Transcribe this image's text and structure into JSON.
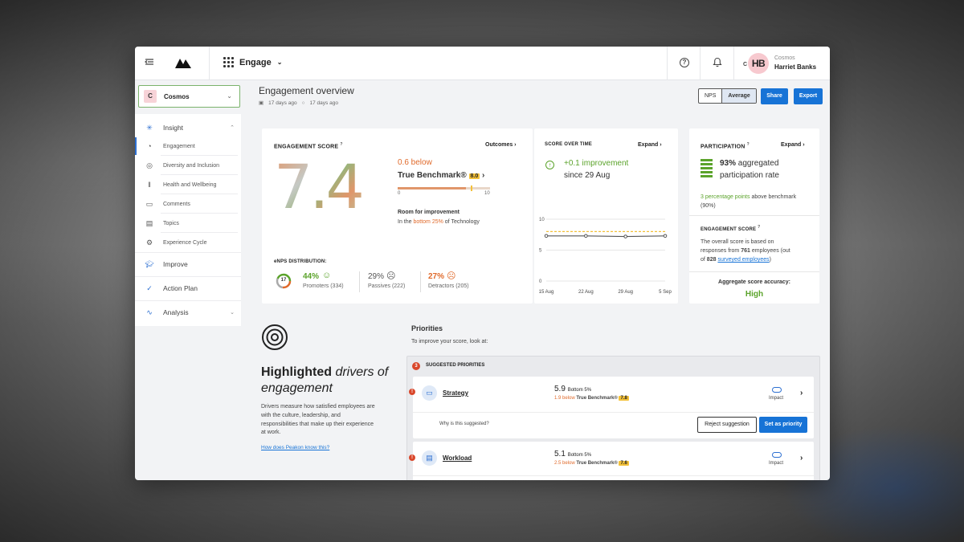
{
  "topbar": {
    "product_label": "Engage",
    "user_org": "Cosmos",
    "user_name": "Harriet Banks",
    "avatar_initials": "HB",
    "avatar_org_initial": "C"
  },
  "org_selector": {
    "badge": "C",
    "name": "Cosmos"
  },
  "sidebar": {
    "insight_label": "Insight",
    "items": [
      {
        "label": "Engagement",
        "icon": "gauge-icon"
      },
      {
        "label": "Diversity and Inclusion",
        "icon": "camera-icon"
      },
      {
        "label": "Health and Wellbeing",
        "icon": "thermometer-icon"
      },
      {
        "label": "Comments",
        "icon": "comment-icon"
      },
      {
        "label": "Topics",
        "icon": "topics-icon"
      },
      {
        "label": "Experience Cycle",
        "icon": "cycle-icon"
      }
    ],
    "improve_label": "Improve",
    "action_plan_label": "Action Plan",
    "analysis_label": "Analysis"
  },
  "header": {
    "title": "Engagement overview",
    "date_1": "17 days ago",
    "date_2": "17 days ago",
    "toggle_nps": "NPS",
    "toggle_average": "Average",
    "share_label": "Share",
    "export_label": "Export"
  },
  "engagement_card": {
    "title": "ENGAGEMENT SCORE",
    "outcomes_link": "Outcomes",
    "score": "7.4",
    "below_text": "0.6 below",
    "benchmark_label": "True Benchmark®",
    "benchmark_value": "8.0",
    "scale_min": "0",
    "scale_max": "10",
    "score_fraction": 0.74,
    "benchmark_fraction": 0.8,
    "room_title": "Room for improvement",
    "room_prefix": "In the",
    "room_highlight": "bottom 25%",
    "room_suffix": "of Technology",
    "enps_title": "eNPS DISTRIBUTION:",
    "enps_score": "17",
    "promoters_pct": "44%",
    "promoters_label": "Promoters (334)",
    "passives_pct": "29%",
    "passives_label": "Passives (222)",
    "detractors_pct": "27%",
    "detractors_label": "Detractors (205)"
  },
  "score_over_time": {
    "title": "SCORE OVER TIME",
    "expand_label": "Expand",
    "improvement": "+0.1 improvement",
    "since": "since 29 Aug"
  },
  "chart_data": {
    "type": "line",
    "x": [
      "15 Aug",
      "22 Aug",
      "29 Aug",
      "5 Sep"
    ],
    "series": [
      {
        "values": [
          7.3,
          7.3,
          7.2,
          7.3
        ]
      },
      {
        "values": [
          8.0,
          8.0,
          8.0,
          8.0
        ]
      }
    ],
    "yticks": [
      "10",
      "5",
      "0"
    ],
    "ylim": [
      0,
      10
    ],
    "xlabel": "",
    "ylabel": "",
    "grid": true,
    "colors": {
      "score": "#555555",
      "benchmark": "#f3c13a"
    }
  },
  "participation": {
    "title": "PARTICIPATION",
    "expand_label": "Expand",
    "rate_pct": "93%",
    "rate_text1": "aggregated",
    "rate_text2": "participation rate",
    "bench_highlight": "3 percentage points",
    "bench_text": "above benchmark",
    "bench_value": "(90%)",
    "score_title": "ENGAGEMENT SCORE",
    "desc_1": "The overall score is based on",
    "desc_2_prefix": "responses from",
    "desc_2_num": "761",
    "desc_2_suffix": "employees (out",
    "desc_3_prefix": "of",
    "desc_3_num": "828",
    "desc_3_link": "surveyed employees",
    "desc_3_suffix": ")",
    "accuracy_title": "Aggregate score accuracy:",
    "accuracy_value": "High"
  },
  "drivers": {
    "title_bold": "Highlighted",
    "title_italic_1": "drivers of",
    "title_italic_2": "engagement",
    "desc_1": "Drivers measure how satisfied employees are",
    "desc_2": "with the culture, leadership, and",
    "desc_3": "responsibilities that make up their experience",
    "desc_4": "at work.",
    "link": "How does Peakon know this?"
  },
  "priorities": {
    "title": "Priorities",
    "subtitle": "To improve your score, look at:",
    "count": "3",
    "suggested_label": "SUGGESTED PRIORITIES",
    "why_text": "Why is this suggested?",
    "reject_label": "Reject suggestion",
    "set_label": "Set as priority",
    "impact_label": "Impact",
    "rows": [
      {
        "name": "Strategy",
        "score": "5.9",
        "rank": "Bottom 5%",
        "below": "1.9 below",
        "bench_label": "True Benchmark®",
        "bench": "7.8"
      },
      {
        "name": "Workload",
        "score": "5.1",
        "rank": "Bottom 5%",
        "below": "2.5 below",
        "bench_label": "True Benchmark®",
        "bench": "7.6"
      }
    ]
  },
  "colors": {
    "accent_blue": "#1773d6",
    "positive_green": "#5ba32b",
    "negative_orange": "#e06a2b",
    "benchmark_yellow": "#f3c13a"
  }
}
